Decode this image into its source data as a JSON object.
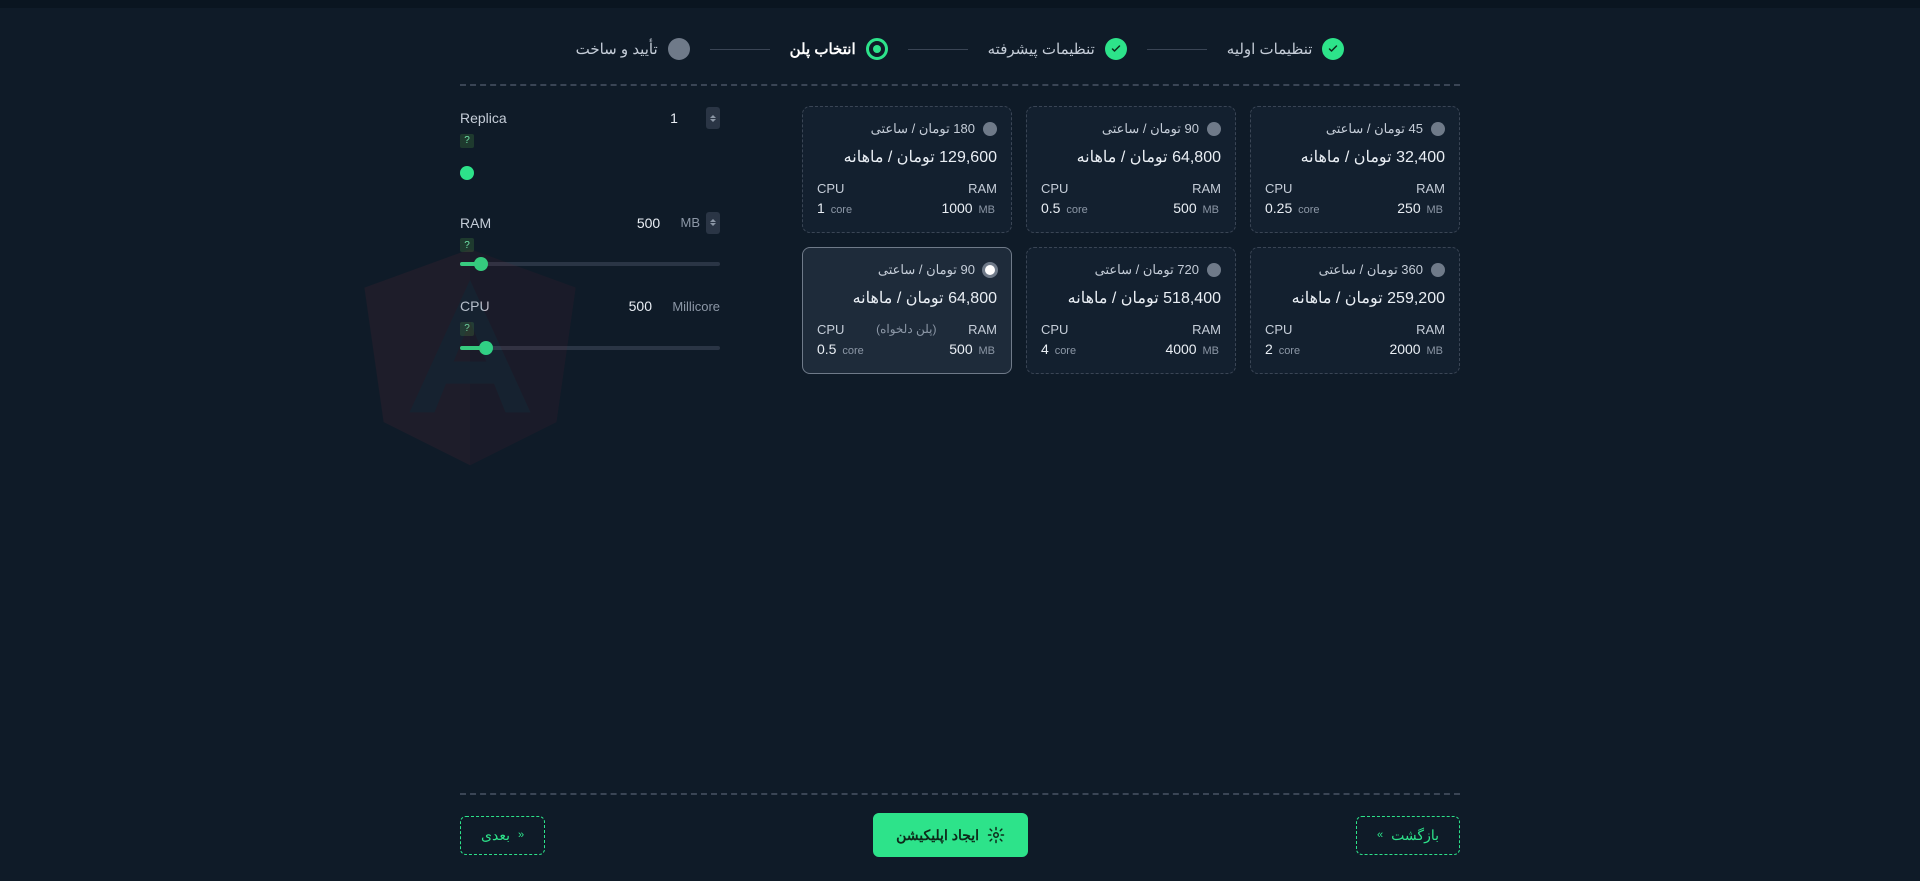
{
  "stepper": {
    "s1": "تنظیمات اولیه",
    "s2": "تنظیمات پیشرفته",
    "s3": "انتخاب پلن",
    "s4": "تأیید و ساخت"
  },
  "labels": {
    "cpu": "CPU",
    "ram": "RAM",
    "core": "core",
    "mb": "MB",
    "custom": "(پلن دلخواه)"
  },
  "plans": [
    {
      "hourly": "45 تومان / ساعتی",
      "monthly": "32,400 تومان / ماهانه",
      "cpu": "0.25",
      "ram": "250"
    },
    {
      "hourly": "90 تومان / ساعتی",
      "monthly": "64,800 تومان / ماهانه",
      "cpu": "0.5",
      "ram": "500"
    },
    {
      "hourly": "180 تومان / ساعتی",
      "monthly": "129,600 تومان / ماهانه",
      "cpu": "1",
      "ram": "1000"
    },
    {
      "hourly": "360 تومان / ساعتی",
      "monthly": "259,200 تومان / ماهانه",
      "cpu": "2",
      "ram": "2000"
    },
    {
      "hourly": "720 تومان / ساعتی",
      "monthly": "518,400 تومان / ماهانه",
      "cpu": "4",
      "ram": "4000"
    },
    {
      "hourly": "90 تومان / ساعتی",
      "monthly": "64,800 تومان / ماهانه",
      "cpu": "0.5",
      "ram": "500",
      "selected": true,
      "custom": true
    }
  ],
  "controls": {
    "replica": {
      "label": "Replica",
      "value": "1"
    },
    "ram": {
      "label": "RAM",
      "value": "500",
      "unit": "MB",
      "fillpct": "8%"
    },
    "cpu": {
      "label": "CPU",
      "value": "500",
      "unit": "Millicore",
      "fillpct": "10%"
    }
  },
  "footer": {
    "back": "بازگشت",
    "create": "ایجاد اپلیکیشن",
    "next": "بعدی"
  }
}
